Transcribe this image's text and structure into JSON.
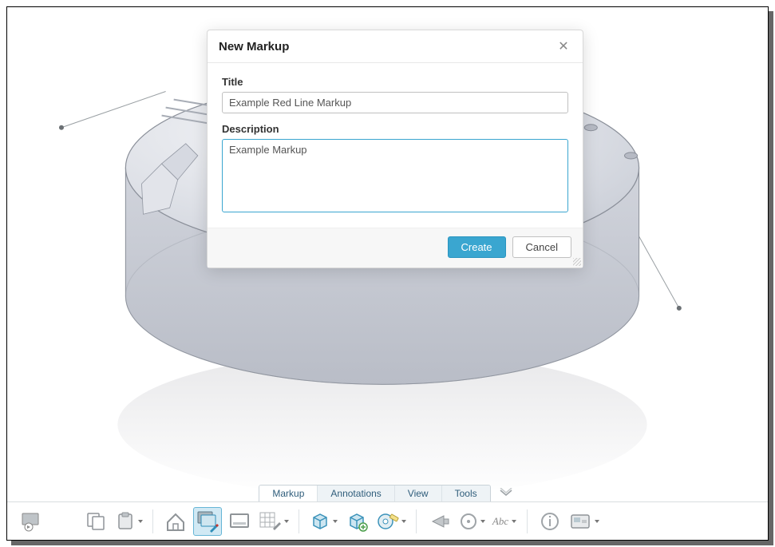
{
  "dialog": {
    "heading": "New Markup",
    "title_label": "Title",
    "title_value": "Example Red Line Markup",
    "description_label": "Description",
    "description_value": "Example Markup",
    "create_label": "Create",
    "cancel_label": "Cancel"
  },
  "tabs": {
    "items": [
      "Markup",
      "Annotations",
      "View",
      "Tools"
    ],
    "active_index": 0
  },
  "toolbar": {
    "text_tool_label": "Abc"
  }
}
